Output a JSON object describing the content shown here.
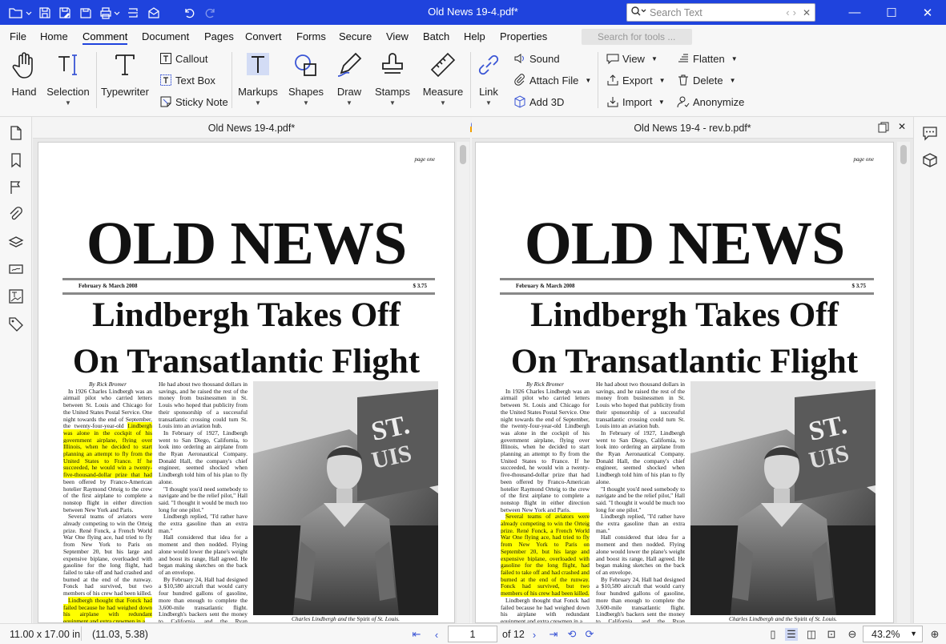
{
  "window": {
    "title": "Old News 19-4.pdf*",
    "search_placeholder": "Search Text"
  },
  "menu": [
    "File",
    "Home",
    "Comment",
    "Document",
    "Pages",
    "Convert",
    "Forms",
    "Secure",
    "View",
    "Batch",
    "Help",
    "Properties"
  ],
  "menu_active": "Comment",
  "tool_search_placeholder": "Search for tools ...",
  "ribbon": {
    "hand": "Hand",
    "selection": "Selection",
    "typewriter": "Typewriter",
    "callout": "Callout",
    "textbox": "Text Box",
    "sticky": "Sticky Note",
    "markups": "Markups",
    "shapes": "Shapes",
    "draw": "Draw",
    "stamps": "Stamps",
    "measure": "Measure",
    "link": "Link",
    "sound": "Sound",
    "attach": "Attach File",
    "add3d": "Add 3D",
    "view": "View",
    "export": "Export",
    "import": "Import",
    "flatten": "Flatten",
    "delete": "Delete",
    "anonymize": "Anonymize"
  },
  "left_doc": {
    "tab": "Old News 19-4.pdf*"
  },
  "right_doc": {
    "tab": "Old News 19-4 - rev.b.pdf*"
  },
  "newspaper": {
    "page_label": "page one",
    "masthead": "OLD NEWS",
    "date": "February & March 2008",
    "price": "$ 3.75",
    "headline1": "Lindbergh Takes Off",
    "headline2": "On Transatlantic Flight",
    "byline": "By Rick Bromer",
    "caption_pre": "Charles Lindbergh and the ",
    "caption_italic": "Spirit",
    "caption_post": " of St. Louis."
  },
  "status": {
    "page_size": "11.00 x 17.00 in",
    "coords": "(11.03, 5.38)",
    "page_current": "1",
    "page_total": "of 12",
    "zoom": "43.2%"
  },
  "colors": {
    "titlebar": "#1f43dd",
    "accent": "#3a55d5",
    "highlight": "#ffff00"
  }
}
